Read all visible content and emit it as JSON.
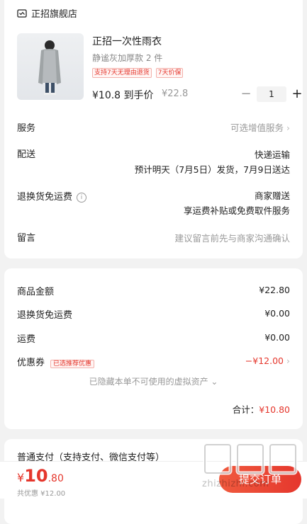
{
  "store": {
    "name": "正招旗舰店",
    "icon": "store-icon"
  },
  "product": {
    "title": "正招一次性雨衣",
    "spec": "静谧灰加厚款 2 件",
    "tags": [
      "支持7天无理由退货",
      "7天价保"
    ],
    "price": "¥10.8 到手价",
    "original_price": "¥22.8",
    "quantity": "1",
    "minus": "−",
    "plus": "+"
  },
  "rows": {
    "service_label": "服务",
    "service_value": "可选增值服务",
    "delivery_label": "配送",
    "delivery_method": "快递运输",
    "delivery_detail": "预计明天（7月5日）发货，7月9日送达",
    "return_label": "退换货免运费",
    "return_value1": "商家赠送",
    "return_value2": "享运费补贴或免费取件服务",
    "message_label": "留言",
    "message_placeholder": "建议留言前先与商家沟通确认"
  },
  "summary": {
    "goods_label": "商品金额",
    "goods_value": "¥22.80",
    "return_label": "退换货免运费",
    "return_value": "¥0.00",
    "ship_label": "运费",
    "ship_value": "¥0.00",
    "coupon_label": "优惠券",
    "coupon_tag": "已选推荐优惠",
    "coupon_value": "−¥12.00",
    "hidden_note": "已隐藏本单不可使用的虚拟资产 ⌄",
    "total_label": "合计：",
    "total_value": "¥10.80"
  },
  "payment": {
    "title": "普通支付（支持支付、微信支付等）"
  },
  "bottom": {
    "yen": "¥",
    "int": "10",
    "dec": ".80",
    "save_note": "共优惠 ¥12.00",
    "submit": "提交订单"
  },
  "watermark": {
    "text": "zhizhizhi.com"
  },
  "colors": {
    "accent": "#e5372d",
    "background": "#f2f2f2"
  }
}
